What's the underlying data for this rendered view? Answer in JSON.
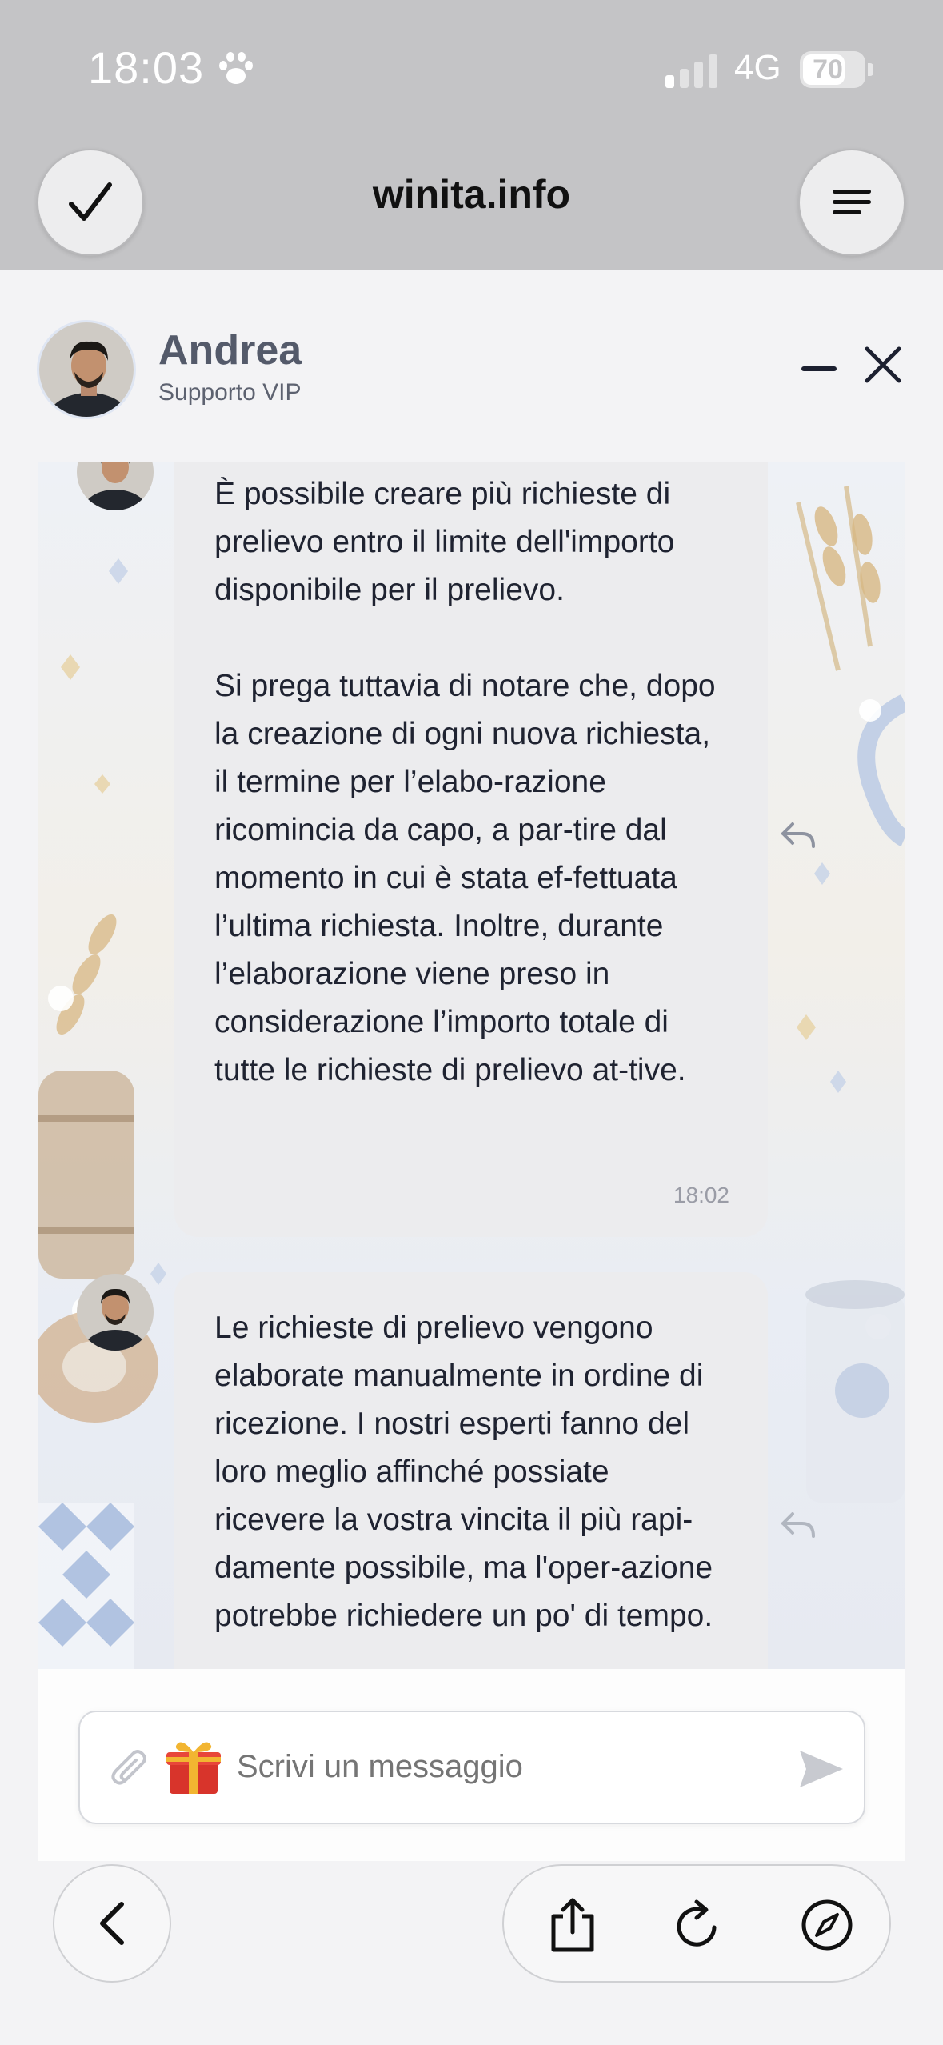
{
  "status_bar": {
    "time": "18:03",
    "network": "4G",
    "battery_pct": "70",
    "battery_level": 0.7
  },
  "browser": {
    "site_title": "winita.info"
  },
  "chat_header": {
    "agent_name": "Andrea",
    "agent_role": "Supporto VIP"
  },
  "messages": [
    {
      "paragraphs": [
        "È possibile creare più richieste di prelievo entro il limite dell'importo disponibile per il prelievo.",
        "Si prega tuttavia di notare che, dopo la creazione di ogni nuova richiesta, il termine per l’elabo-razione ricomincia da capo, a par-tire dal momento in cui è stata ef-fettuata l’ultima richiesta. Inoltre, durante l’elaborazione viene preso in considerazione l’importo totale di tutte le richieste di prelievo at-tive."
      ],
      "time": "18:02"
    },
    {
      "paragraphs": [
        "Le richieste di prelievo vengono elaborate manualmente in ordine di ricezione. I nostri esperti fanno del loro meglio affinché possiate ricevere la vostra vincita il più rapi-damente possibile, ma l'oper-azione potrebbe richiedere un po' di tempo."
      ]
    }
  ],
  "composer": {
    "placeholder": "Scrivi un messaggio"
  },
  "colors": {
    "header_bg": "#c4c4c6",
    "bubble_bg": "#ececee",
    "accent_icon": "#c8cad0"
  },
  "icons": [
    "paw-icon",
    "signal-icon",
    "battery-icon",
    "checkmark-icon",
    "menu-icon",
    "minimize-icon",
    "close-icon",
    "reply-icon",
    "paperclip-icon",
    "gift-icon",
    "send-icon",
    "back-icon",
    "share-icon",
    "reload-icon",
    "compass-icon"
  ]
}
